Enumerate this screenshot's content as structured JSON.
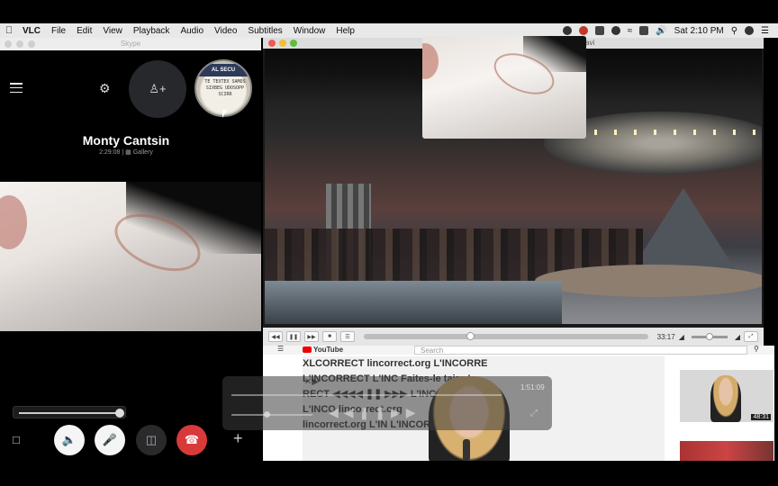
{
  "menubar": {
    "app": "VLC",
    "items": [
      "File",
      "Edit",
      "View",
      "Playback",
      "Audio",
      "Video",
      "Subtitles",
      "Window",
      "Help"
    ],
    "clock": "Sat 2:10 PM"
  },
  "skype": {
    "window_title": "Skype",
    "call": {
      "name": "Monty Cantsin",
      "duration": "2:29:08",
      "separator": "|",
      "mode": "Gallery"
    },
    "avatar_band": "AL SECU",
    "avatar_stamp": "TE TEXTEX SAMOS SIXBEG UDOSOPP SCIRR"
  },
  "vlc": {
    "window_title": "avi",
    "time_remaining": "33:17"
  },
  "browser": {
    "logo": "YouTube",
    "search_placeholder": "Search",
    "wall_rows": [
      "XLCORRECT   lincorrect.org   L'INCORRE",
      "L'INCORRECT   L'INC        Faites-le taire !",
      "RECT   ◀◀◀◀ ❚❚ ▶▶▶   L'INCORRECT",
      "L'INCO              lincorrect.org",
      "lincorrect.org   L'IN       L'INCORRECT"
    ],
    "side_duration": "48:31"
  },
  "overlay": {
    "time": "1:51:09"
  }
}
